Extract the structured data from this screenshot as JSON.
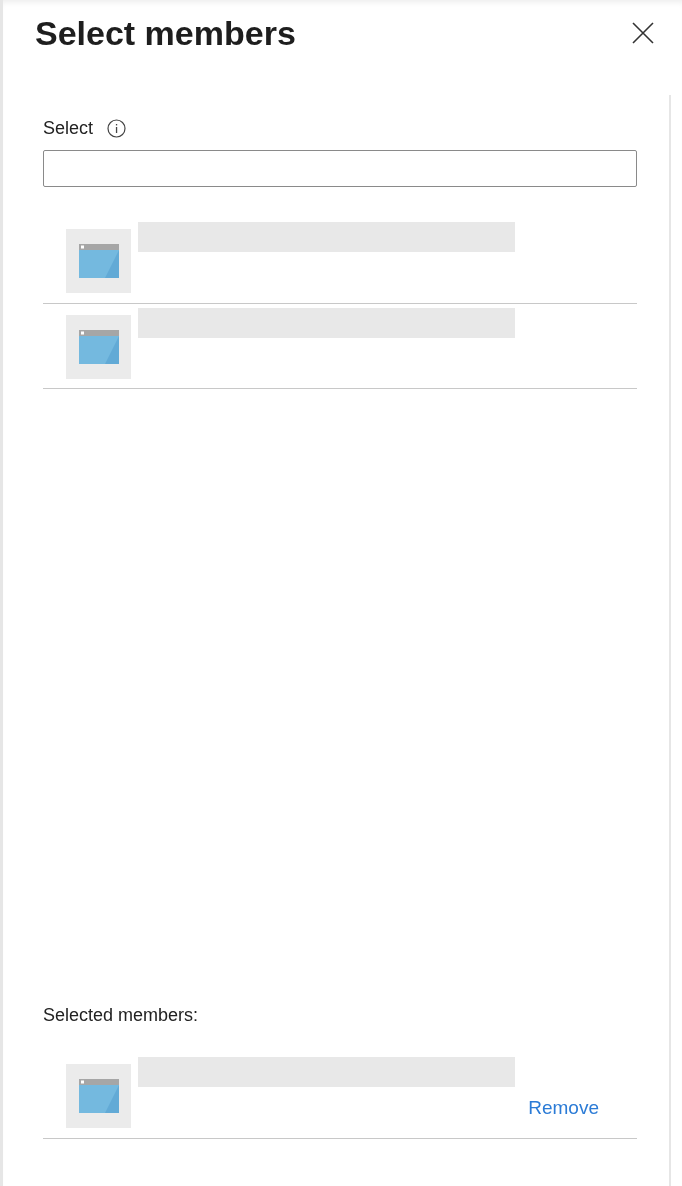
{
  "title": "Select members",
  "select": {
    "label": "Select"
  },
  "results": [
    {
      "kind": "app",
      "redacted": true
    },
    {
      "kind": "app",
      "redacted": true
    }
  ],
  "selected": {
    "label": "Selected members:",
    "items": [
      {
        "kind": "app",
        "redacted": true,
        "action": "Remove"
      }
    ]
  }
}
